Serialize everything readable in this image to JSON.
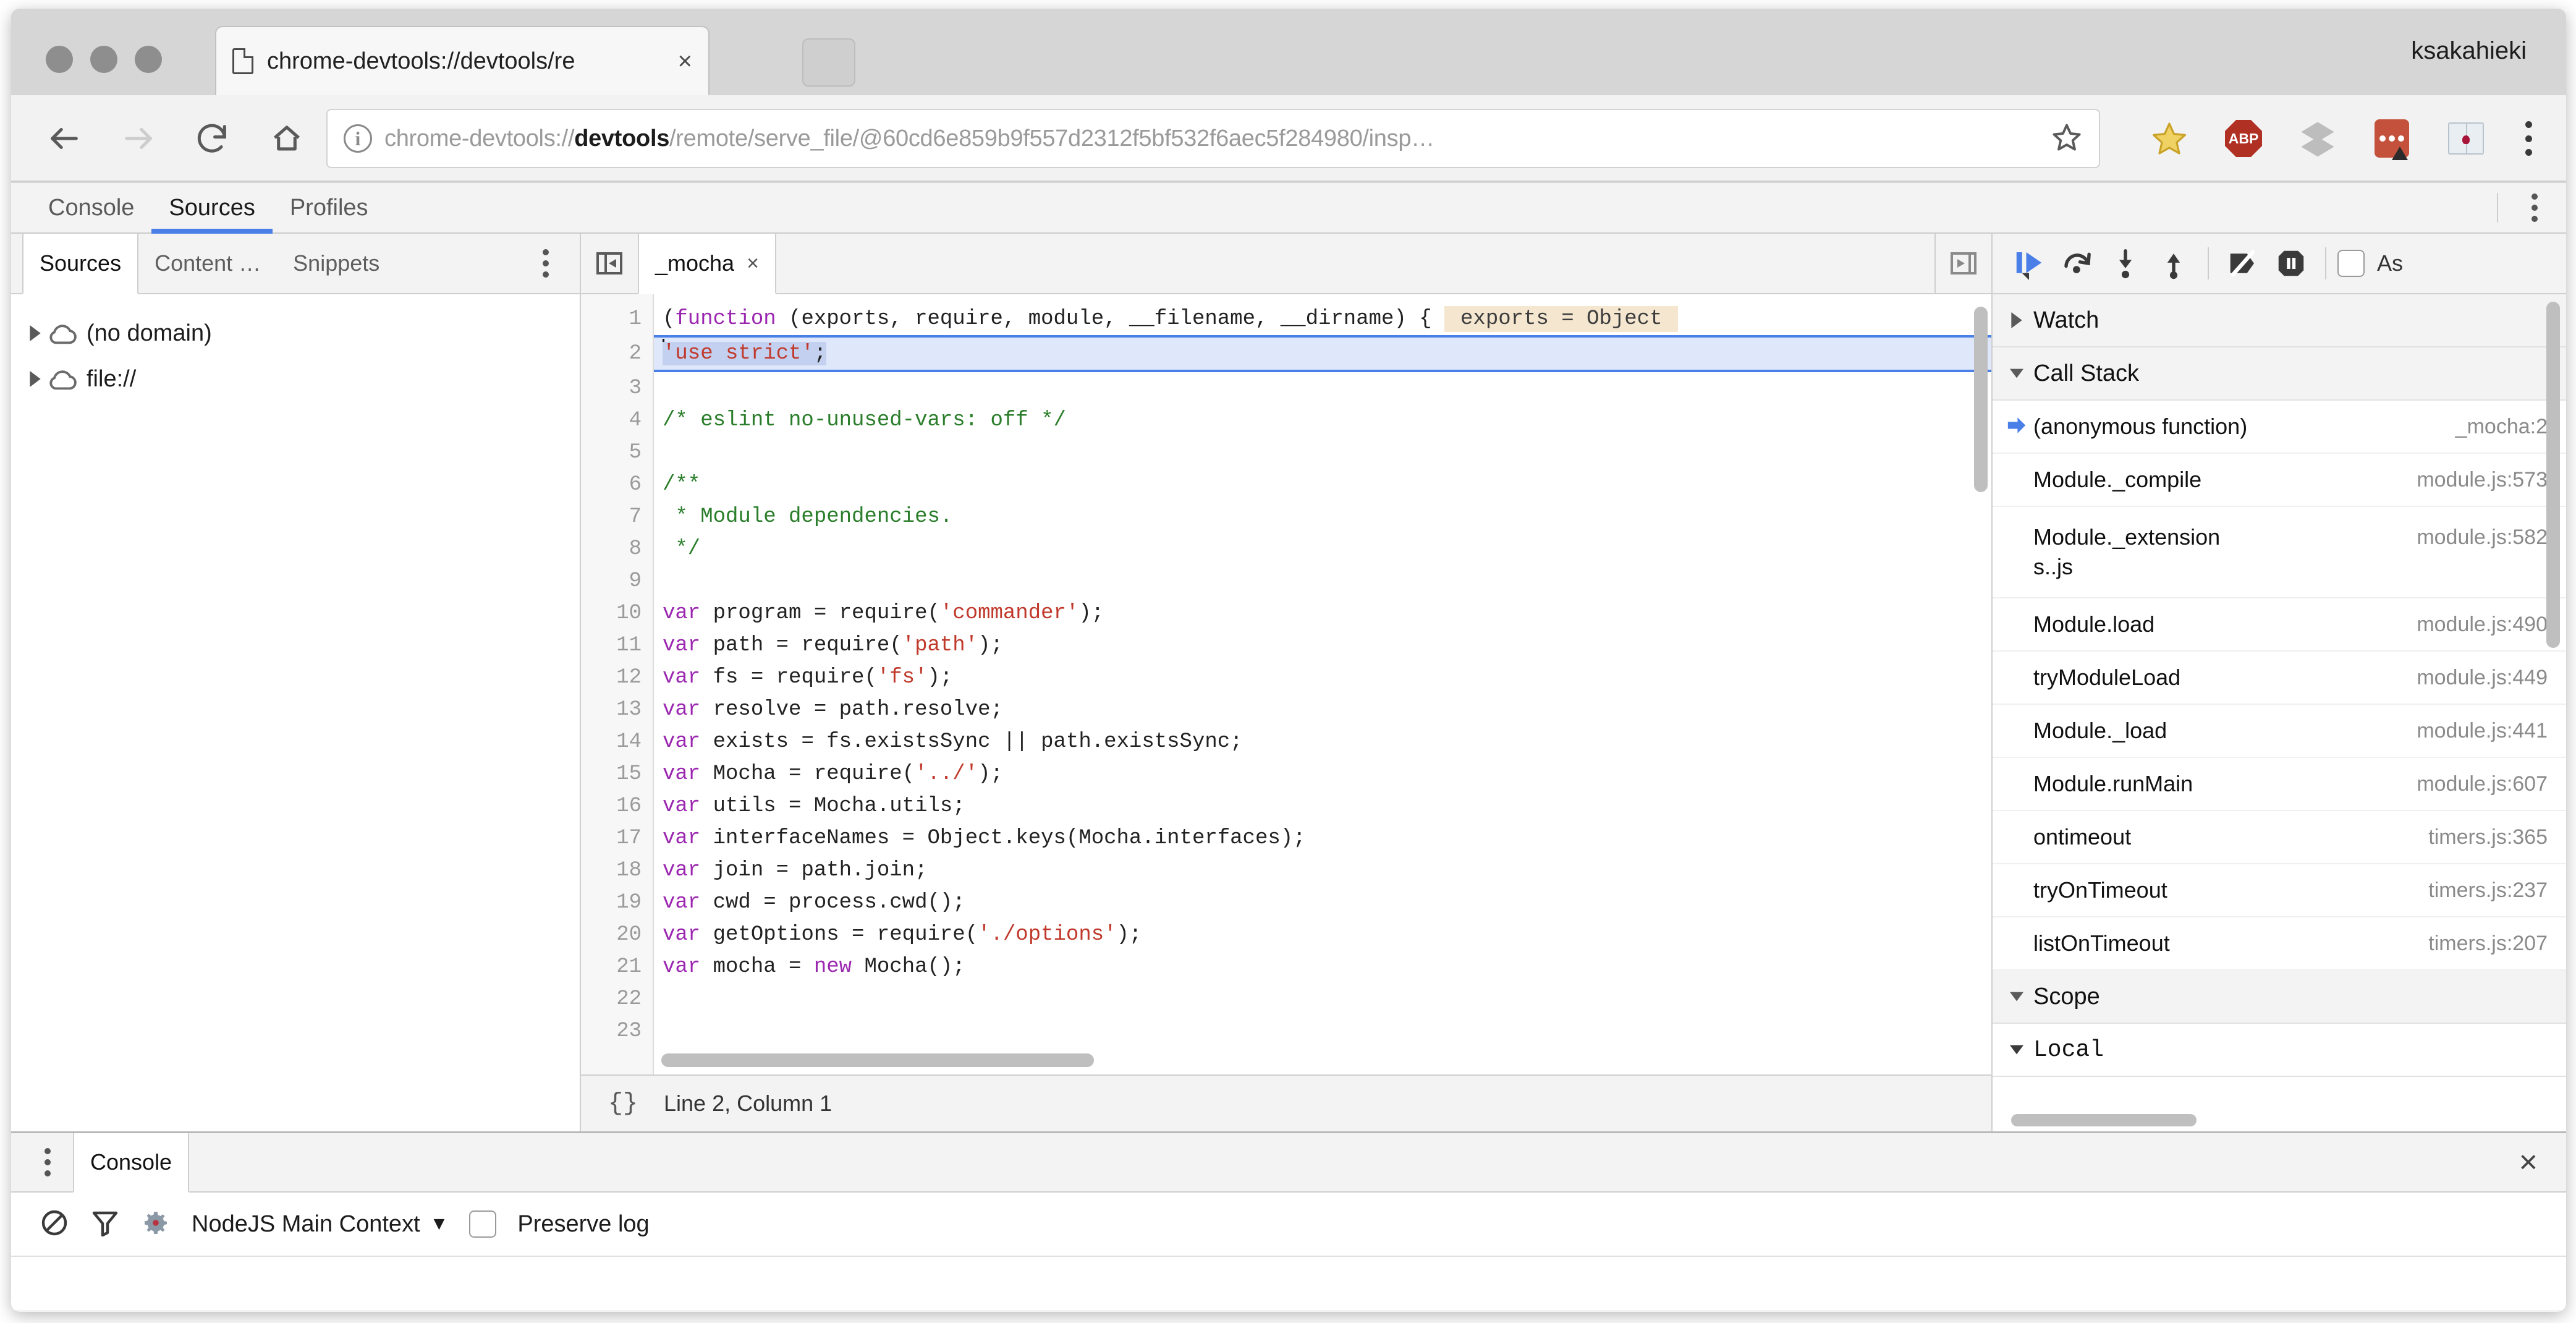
{
  "window": {
    "user_label": "ksakahieki",
    "traffic_lights": [
      "close",
      "minimize",
      "zoom"
    ]
  },
  "tab": {
    "title": "chrome-devtools://devtools/re",
    "close": "×",
    "favicon": "page-icon",
    "new_tab": "+"
  },
  "omnibox": {
    "info_icon": "ⓘ",
    "url_prefix": "chrome-devtools://",
    "url_bold": "devtools",
    "url_suffix": "/remote/serve_file/@60cd6e859b9f557d2312f5bf532f6aec5f284980/insp…",
    "url_full": "chrome-devtools://devtools/remote/serve_file/@60cd6e859b9f557d2312f5bf532f6aec5f284980/insp…",
    "nav": {
      "back": "back-arrow",
      "forward": "forward-arrow",
      "reload": "reload",
      "home": "home"
    },
    "extensions": [
      {
        "name": "bookmark-star",
        "label": ""
      },
      {
        "name": "adblock-plus",
        "label": "ABP"
      },
      {
        "name": "layers",
        "label": ""
      },
      {
        "name": "password-manager",
        "label": ""
      },
      {
        "name": "dictionary-book",
        "label": ""
      }
    ],
    "menu": "browser-menu"
  },
  "devtools": {
    "main_tabs": [
      {
        "label": "Console",
        "active": false
      },
      {
        "label": "Sources",
        "active": true
      },
      {
        "label": "Profiles",
        "active": false
      }
    ],
    "accent_color": "#4a7fe8",
    "navigator": {
      "tabs": [
        {
          "label": "Sources",
          "active": true
        },
        {
          "label": "Content …",
          "active": false
        },
        {
          "label": "Snippets",
          "active": false
        }
      ],
      "tree": [
        {
          "label": "(no domain)",
          "icon": "cloud-icon",
          "expanded": false
        },
        {
          "label": "file://",
          "icon": "cloud-icon",
          "expanded": false
        }
      ]
    },
    "editor": {
      "collapse_left_icon": "panel-collapse-left-icon",
      "collapse_right_icon": "panel-expand-right-icon",
      "file_tab": {
        "label": "_mocha",
        "close": "×"
      },
      "inline_hint": "exports = Object",
      "status": {
        "pretty_print": "{}",
        "cursor": "Line 2, Column 1"
      },
      "lines": [
        {
          "n": 1,
          "tokens": [
            {
              "t": "(",
              "c": "plain"
            },
            {
              "t": "function",
              "c": "kw"
            },
            {
              "t": " (exports, require, module, __filename, __dirname) { ",
              "c": "plain"
            }
          ],
          "hint": "exports = Object"
        },
        {
          "n": 2,
          "exec": true,
          "tokens": [
            {
              "t": "'use strict'",
              "c": "str"
            },
            {
              "t": ";",
              "c": "plain"
            }
          ]
        },
        {
          "n": 3,
          "tokens": []
        },
        {
          "n": 4,
          "tokens": [
            {
              "t": "/* eslint no-unused-vars: off */",
              "c": "cmt"
            }
          ]
        },
        {
          "n": 5,
          "tokens": []
        },
        {
          "n": 6,
          "tokens": [
            {
              "t": "/**",
              "c": "cmt"
            }
          ]
        },
        {
          "n": 7,
          "tokens": [
            {
              "t": " * Module dependencies.",
              "c": "cmt"
            }
          ]
        },
        {
          "n": 8,
          "tokens": [
            {
              "t": " */",
              "c": "cmt"
            }
          ]
        },
        {
          "n": 9,
          "tokens": []
        },
        {
          "n": 10,
          "tokens": [
            {
              "t": "var",
              "c": "kw"
            },
            {
              "t": " program = require(",
              "c": "plain"
            },
            {
              "t": "'commander'",
              "c": "str"
            },
            {
              "t": ");",
              "c": "plain"
            }
          ]
        },
        {
          "n": 11,
          "tokens": [
            {
              "t": "var",
              "c": "kw"
            },
            {
              "t": " path = require(",
              "c": "plain"
            },
            {
              "t": "'path'",
              "c": "str"
            },
            {
              "t": ");",
              "c": "plain"
            }
          ]
        },
        {
          "n": 12,
          "tokens": [
            {
              "t": "var",
              "c": "kw"
            },
            {
              "t": " fs = require(",
              "c": "plain"
            },
            {
              "t": "'fs'",
              "c": "str"
            },
            {
              "t": ");",
              "c": "plain"
            }
          ]
        },
        {
          "n": 13,
          "tokens": [
            {
              "t": "var",
              "c": "kw"
            },
            {
              "t": " resolve = path.resolve;",
              "c": "plain"
            }
          ]
        },
        {
          "n": 14,
          "tokens": [
            {
              "t": "var",
              "c": "kw"
            },
            {
              "t": " exists = fs.existsSync || path.existsSync;",
              "c": "plain"
            }
          ]
        },
        {
          "n": 15,
          "tokens": [
            {
              "t": "var",
              "c": "kw"
            },
            {
              "t": " Mocha = require(",
              "c": "plain"
            },
            {
              "t": "'../'",
              "c": "str"
            },
            {
              "t": ");",
              "c": "plain"
            }
          ]
        },
        {
          "n": 16,
          "tokens": [
            {
              "t": "var",
              "c": "kw"
            },
            {
              "t": " utils = Mocha.utils;",
              "c": "plain"
            }
          ]
        },
        {
          "n": 17,
          "tokens": [
            {
              "t": "var",
              "c": "kw"
            },
            {
              "t": " interfaceNames = Object.keys(Mocha.interfaces);",
              "c": "plain"
            }
          ]
        },
        {
          "n": 18,
          "tokens": [
            {
              "t": "var",
              "c": "kw"
            },
            {
              "t": " join = path.join;",
              "c": "plain"
            }
          ]
        },
        {
          "n": 19,
          "tokens": [
            {
              "t": "var",
              "c": "kw"
            },
            {
              "t": " cwd = process.cwd();",
              "c": "plain"
            }
          ]
        },
        {
          "n": 20,
          "tokens": [
            {
              "t": "var",
              "c": "kw"
            },
            {
              "t": " getOptions = require(",
              "c": "plain"
            },
            {
              "t": "'./options'",
              "c": "str"
            },
            {
              "t": ");",
              "c": "plain"
            }
          ]
        },
        {
          "n": 21,
          "tokens": [
            {
              "t": "var",
              "c": "kw"
            },
            {
              "t": " mocha = ",
              "c": "plain"
            },
            {
              "t": "new",
              "c": "kw"
            },
            {
              "t": " Mocha();",
              "c": "plain"
            }
          ]
        },
        {
          "n": 22,
          "tokens": []
        },
        {
          "n": 23,
          "tokens": []
        }
      ]
    },
    "debugger": {
      "buttons": [
        {
          "name": "resume-script-execution",
          "icon": "resume-icon"
        },
        {
          "name": "step-over",
          "icon": "step-over-icon"
        },
        {
          "name": "step-into",
          "icon": "step-into-icon"
        },
        {
          "name": "step-out",
          "icon": "step-out-icon"
        },
        {
          "name": "deactivate-breakpoints",
          "icon": "deactivate-breakpoints-icon"
        },
        {
          "name": "pause-on-exceptions",
          "icon": "pause-icon"
        }
      ],
      "async_checkbox": {
        "label": "As",
        "checked": false
      },
      "sections": [
        {
          "title": "Watch",
          "expanded": false
        },
        {
          "title": "Call Stack",
          "expanded": true
        },
        {
          "title": "Scope",
          "expanded": true
        },
        {
          "title": "Local",
          "expanded": true
        }
      ],
      "call_stack": [
        {
          "name": "(anonymous function)",
          "location": "_mocha:2",
          "current": true
        },
        {
          "name": "Module._compile",
          "location": "module.js:573",
          "current": false
        },
        {
          "name": "Module._extension",
          "name2": "s..js",
          "location": "module.js:582",
          "current": false
        },
        {
          "name": "Module.load",
          "location": "module.js:490",
          "current": false
        },
        {
          "name": "tryModuleLoad",
          "location": "module.js:449",
          "current": false
        },
        {
          "name": "Module._load",
          "location": "module.js:441",
          "current": false
        },
        {
          "name": "Module.runMain",
          "location": "module.js:607",
          "current": false
        },
        {
          "name": "ontimeout",
          "location": "timers.js:365",
          "current": false
        },
        {
          "name": "tryOnTimeout",
          "location": "timers.js:237",
          "current": false
        },
        {
          "name": "listOnTimeout",
          "location": "timers.js:207",
          "current": false
        }
      ]
    },
    "drawer": {
      "tab": "Console",
      "close": "×",
      "toolbar": {
        "clear_icon": "clear-console-icon",
        "filter_icon": "filter-icon",
        "settings_icon": "gear-icon",
        "context": "NodeJS Main Context",
        "context_caret": "▼",
        "preserve_log": "Preserve log",
        "preserve_checked": false
      }
    }
  }
}
